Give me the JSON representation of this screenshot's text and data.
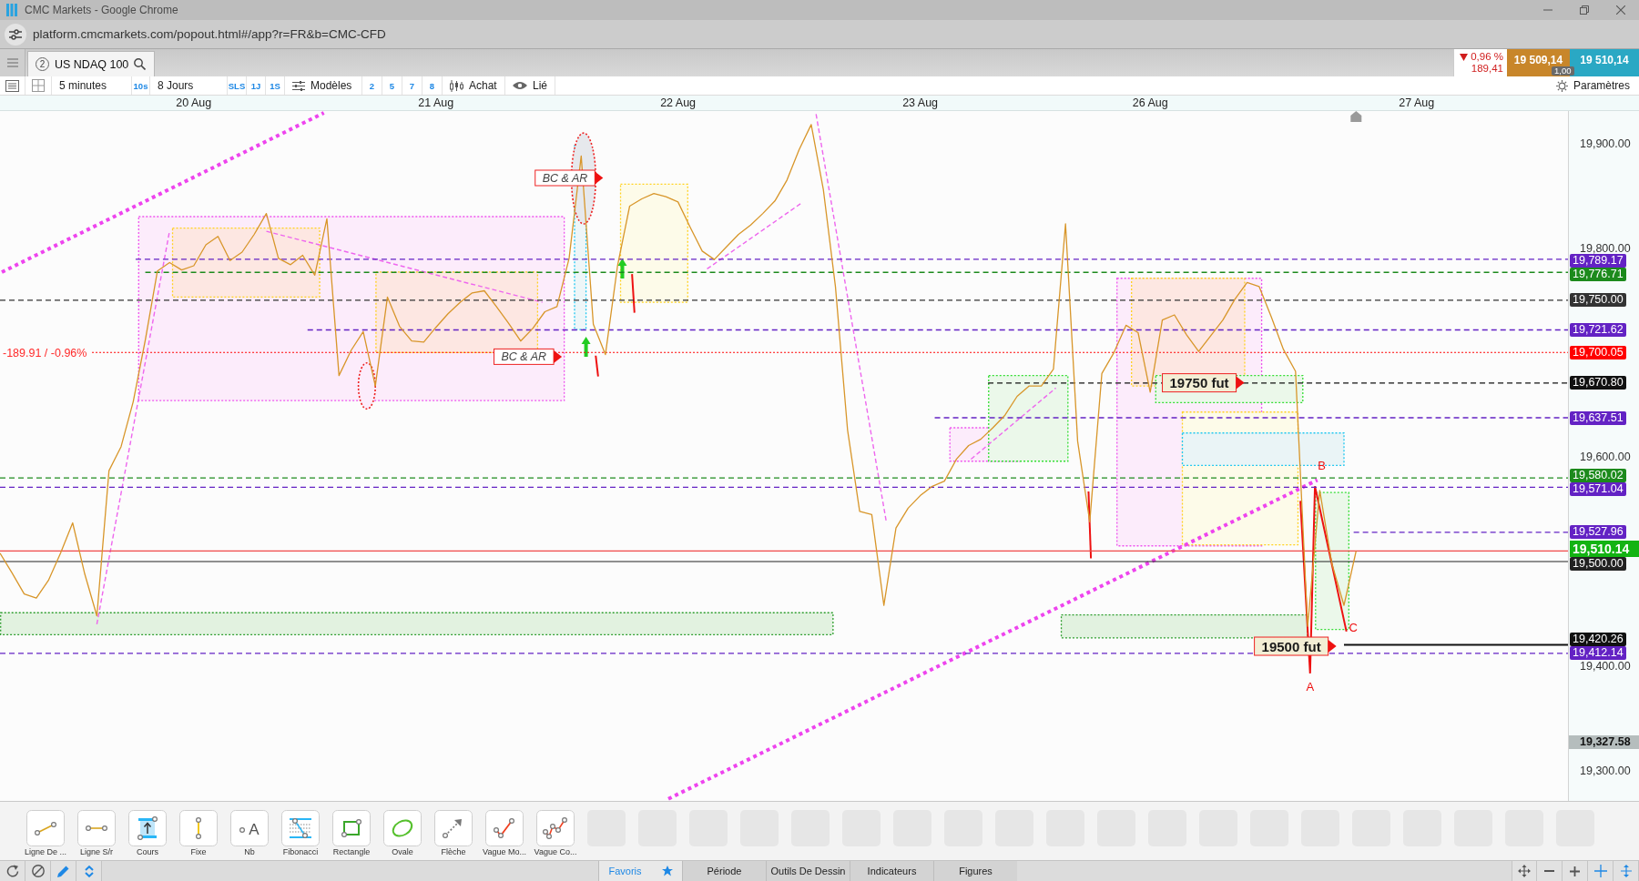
{
  "window": {
    "title": "CMC Markets - Google Chrome"
  },
  "address_bar": {
    "url": "platform.cmcmarkets.com/popout.html#/app?r=FR&b=CMC-CFD"
  },
  "instrument_tab": {
    "number": "2",
    "label": "US NDAQ 100"
  },
  "quote": {
    "falling": true,
    "change_percent": "0,96 %",
    "change_points": "189,41",
    "sell": "19 509,14",
    "spread": "1,00",
    "buy": "19 510,14"
  },
  "toolbar": {
    "interval": "5 minutes",
    "interval_shortcuts": [
      "10s"
    ],
    "period": "8 Jours",
    "period_shortcuts": [
      "SLS",
      "1J",
      "1S"
    ],
    "templates": "Modèles",
    "template_shortcuts": [
      "2",
      "5",
      "7",
      "8"
    ],
    "trade": "Achat",
    "link": "Lié",
    "settings": "Paramètres"
  },
  "chart": {
    "chart_data": {
      "type": "line",
      "ylim": [
        19271,
        19931
      ],
      "categories": [
        null,
        null,
        null,
        null,
        null,
        null,
        null,
        null,
        null,
        null,
        null,
        null,
        null,
        null,
        null,
        null,
        "20 Aug",
        null,
        null,
        null,
        null,
        null,
        null,
        null,
        null,
        null,
        null,
        null,
        null,
        null,
        null,
        null,
        null,
        null,
        null,
        null,
        "21 Aug",
        null,
        null,
        null,
        null,
        null,
        null,
        null,
        null,
        null,
        null,
        null,
        null,
        null,
        null,
        null,
        null,
        null,
        null,
        null,
        "22 Aug",
        null,
        null,
        null,
        null,
        null,
        null,
        null,
        null,
        null,
        null,
        null,
        null,
        null,
        null,
        null,
        null,
        null,
        null,
        null,
        "23 Aug",
        null,
        null,
        null,
        null,
        null,
        null,
        null,
        null,
        null,
        null,
        null,
        null,
        null,
        null,
        null,
        null,
        null,
        null,
        "26 Aug",
        null,
        null,
        null,
        null,
        null,
        null,
        null,
        null,
        null,
        null,
        null,
        null,
        null,
        null,
        null,
        null,
        null,
        null,
        null,
        null,
        null,
        "27 Aug",
        null,
        null,
        null,
        null,
        null,
        null,
        null,
        null,
        null,
        null,
        null,
        null
      ],
      "yticks": [
        {
          "value": 19900,
          "label": "19,900.00"
        },
        {
          "value": 19800,
          "label": "19,800.00"
        },
        {
          "value": 19600,
          "label": "19,600.00"
        },
        {
          "value": 19400,
          "label": "19,400.00"
        },
        {
          "value": 19327.58,
          "label": "19,327.58"
        },
        {
          "value": 19300,
          "label": "19,300.00"
        }
      ],
      "series": [
        {
          "color": "#d8962a",
          "values": [
            19508,
            19489,
            19469,
            19465,
            19482,
            19508,
            19537,
            19488,
            19448,
            19587,
            19610,
            19653,
            19712,
            19778,
            19786,
            19779,
            19783,
            19803,
            19811,
            19788,
            19796,
            19813,
            19833,
            19790,
            19784,
            19793,
            19774,
            19828,
            19678,
            19702,
            19720,
            19668,
            19753,
            19725,
            19711,
            19710,
            19724,
            19737,
            19748,
            19757,
            19759,
            19744,
            19728,
            19711,
            19723,
            19739,
            19744,
            19790,
            19888,
            19727,
            19698,
            19783,
            19840,
            19847,
            19852,
            19849,
            19844,
            19820,
            19797,
            19789,
            19801,
            19813,
            19822,
            19833,
            19845,
            19865,
            19894,
            19918,
            19856,
            19763,
            19626,
            19548,
            19545,
            19458,
            19532,
            19551,
            19563,
            19572,
            19577,
            19598,
            19611,
            19617,
            19628,
            19640,
            19658,
            19668,
            19668,
            19684,
            19823,
            19615,
            19538,
            19680,
            19700,
            19726,
            19719,
            19662,
            19731,
            19736,
            19717,
            19701,
            19716,
            19731,
            19751,
            19767,
            19763,
            19734,
            19703,
            19682,
            19438,
            19568,
            19498,
            19458,
            19510,
            null,
            null,
            null,
            null,
            null,
            null,
            null,
            null,
            null,
            null,
            null,
            null,
            null,
            null,
            null,
            null,
            null
          ]
        }
      ],
      "ref_lines": [
        {
          "axis": "y",
          "value": 19789.17,
          "label": "19,789.17",
          "color": "#6322c4"
        },
        {
          "axis": "y",
          "value": 19776.71,
          "label": "19,776.71",
          "color": "#1c8a1c"
        },
        {
          "axis": "y",
          "value": 19750,
          "label": "19,750.00",
          "color": "#333333"
        },
        {
          "axis": "y",
          "value": 19721.62,
          "label": "19,721.62",
          "color": "#6322c4"
        },
        {
          "axis": "y",
          "value": 19700.05,
          "label": "19,700.05",
          "color": "#ff0000"
        },
        {
          "axis": "y",
          "value": 19670.8,
          "label": "19,670.80",
          "color": "#111111"
        },
        {
          "axis": "y",
          "value": 19637.51,
          "label": "19,637.51",
          "color": "#6322c4"
        },
        {
          "axis": "y",
          "value": 19580.02,
          "label": "19,580.02",
          "color": "#1c8a1c"
        },
        {
          "axis": "y",
          "value": 19571.04,
          "label": "19,571.04",
          "color": "#6322c4"
        },
        {
          "axis": "y",
          "value": 19527.96,
          "label": "19,527.96",
          "color": "#6322c4"
        },
        {
          "axis": "y",
          "value": 19510.14,
          "label": "19,510.14",
          "color": "#f04848"
        },
        {
          "axis": "y",
          "value": 19500,
          "label": "19,500.00",
          "color": "#222222"
        },
        {
          "axis": "y",
          "value": 19420.26,
          "label": "19,420.26",
          "color": "#111111"
        },
        {
          "axis": "y",
          "value": 19412.14,
          "label": "19,412.14",
          "color": "#6322c4"
        }
      ],
      "annotations": [
        "BC & AR",
        "BC & AR",
        "19750 fut",
        "19500 fut",
        "A",
        "B",
        "C",
        "-189.91 / -0.96%"
      ]
    }
  },
  "drawing_tools": [
    {
      "kind": "trend",
      "label": "Ligne De ..."
    },
    {
      "kind": "hline",
      "label": "Ligne S/r"
    },
    {
      "kind": "price",
      "label": "Cours"
    },
    {
      "kind": "vline",
      "label": "Fixe"
    },
    {
      "kind": "text",
      "label": "Nb",
      "glyph": "A"
    },
    {
      "kind": "fibonacci",
      "label": "Fibonacci"
    },
    {
      "kind": "rectangle",
      "label": "Rectangle"
    },
    {
      "kind": "ellipse",
      "label": "Ovale"
    },
    {
      "kind": "arrow",
      "label": "Flèche"
    },
    {
      "kind": "wave",
      "label": "Vague Mo..."
    },
    {
      "kind": "wave-complex",
      "label": "Vague Co..."
    }
  ],
  "bottom_tabs": [
    {
      "kind": "favorites",
      "label": "Favoris",
      "selected": true
    },
    {
      "kind": "section",
      "label": "Période",
      "selected": false
    },
    {
      "kind": "section",
      "label": "Outils De Dessin",
      "selected": false
    },
    {
      "kind": "section",
      "label": "Indicateurs",
      "selected": false
    },
    {
      "kind": "section",
      "label": "Figures",
      "selected": false
    }
  ]
}
